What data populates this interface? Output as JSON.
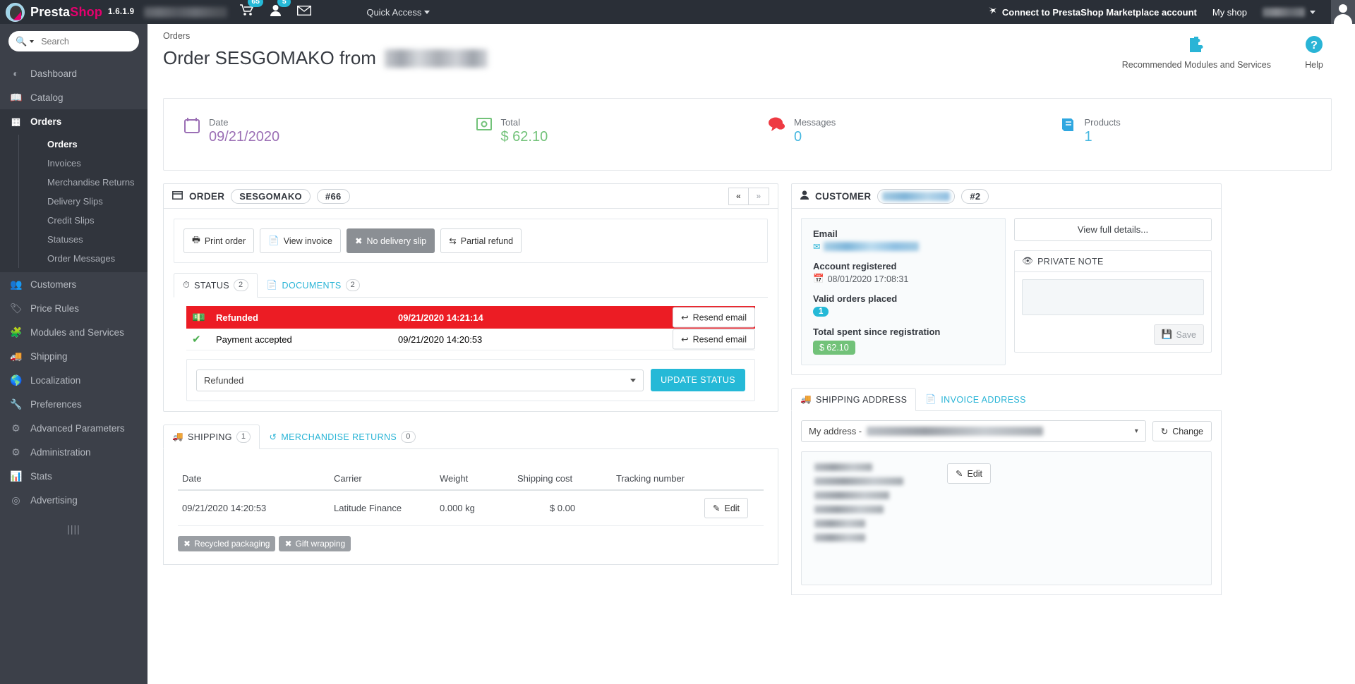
{
  "topbar": {
    "brand": "PrestaShop",
    "brand_pink_part": "Shop",
    "brand_plain_part": "Presta",
    "version": "1.6.1.9",
    "shop_name_redacted": true,
    "cart_badge": "65",
    "customer_badge": "5",
    "quick_access": "Quick Access",
    "connect_label": "Connect to PrestaShop Marketplace account",
    "my_shop": "My shop",
    "employee_name_redacted": true,
    "icons": {
      "cart": "cart-icon",
      "customers": "person-icon",
      "mail": "envelope-icon",
      "connect": "prestashop-mark-icon",
      "avatar": "avatar"
    }
  },
  "sidebar": {
    "search_placeholder": "Search",
    "items": [
      {
        "label": "Dashboard",
        "icon": "dashboard-icon",
        "active": false
      },
      {
        "label": "Catalog",
        "icon": "book-icon",
        "active": false
      },
      {
        "label": "Orders",
        "icon": "credit-card-icon",
        "active": true
      },
      {
        "label": "Customers",
        "icon": "users-icon",
        "active": false
      },
      {
        "label": "Price Rules",
        "icon": "tag-icon",
        "active": false
      },
      {
        "label": "Modules and Services",
        "icon": "puzzle-icon",
        "active": false
      },
      {
        "label": "Shipping",
        "icon": "truck-icon",
        "active": false
      },
      {
        "label": "Localization",
        "icon": "globe-icon",
        "active": false
      },
      {
        "label": "Preferences",
        "icon": "wrench-icon",
        "active": false
      },
      {
        "label": "Advanced Parameters",
        "icon": "cogs-icon",
        "active": false
      },
      {
        "label": "Administration",
        "icon": "gear-icon",
        "active": false
      },
      {
        "label": "Stats",
        "icon": "bar-chart-icon",
        "active": false
      },
      {
        "label": "Advertising",
        "icon": "bullseye-icon",
        "active": false
      }
    ],
    "submenu": [
      {
        "label": "Orders",
        "active": true
      },
      {
        "label": "Invoices",
        "active": false
      },
      {
        "label": "Merchandise Returns",
        "active": false
      },
      {
        "label": "Delivery Slips",
        "active": false
      },
      {
        "label": "Credit Slips",
        "active": false
      },
      {
        "label": "Statuses",
        "active": false
      },
      {
        "label": "Order Messages",
        "active": false
      }
    ]
  },
  "page": {
    "breadcrumb": "Orders",
    "title_prefix": "Order SESGOMAKO from",
    "customer_name_redacted": true,
    "tools": [
      {
        "label": "Recommended Modules and Services",
        "icon": "puzzle-icon"
      },
      {
        "label": "Help",
        "icon": "help-icon"
      }
    ]
  },
  "kpis": [
    {
      "label": "Date",
      "value": "09/21/2020",
      "icon": "calendar-icon",
      "icon_color": "#9b6fb5",
      "value_color": "#9b6fb5"
    },
    {
      "label": "Total",
      "value": "$ 62.10",
      "icon": "money-icon",
      "icon_color": "#72c279",
      "value_color": "#72c279"
    },
    {
      "label": "Messages",
      "value": "0",
      "icon": "chat-icon",
      "icon_color": "#ee3a42",
      "value_color": "#45b7e0"
    },
    {
      "label": "Products",
      "value": "1",
      "icon": "book-icon",
      "icon_color": "#2fa7e0",
      "value_color": "#45b7e0"
    }
  ],
  "order_panel": {
    "header_label": "ORDER",
    "reference": "SESGOMAKO",
    "id": "#66",
    "nav_prev": "«",
    "nav_next": "»",
    "actions": [
      {
        "label": "Print order",
        "icon": "printer-icon",
        "style": "default"
      },
      {
        "label": "View invoice",
        "icon": "file-icon",
        "style": "default"
      },
      {
        "label": "No delivery slip",
        "icon": "x-icon",
        "style": "gray-solid"
      },
      {
        "label": "Partial refund",
        "icon": "exchange-icon",
        "style": "default"
      }
    ],
    "tabs": [
      {
        "label": "STATUS",
        "count": "2",
        "icon": "clock-icon",
        "active": true
      },
      {
        "label": "DOCUMENTS",
        "count": "2",
        "icon": "file-icon",
        "active": false
      }
    ],
    "statuses": [
      {
        "name": "Refunded",
        "date": "09/21/2020 14:21:14",
        "icon": "money-icon",
        "button": "Resend email",
        "highlight": true
      },
      {
        "name": "Payment accepted",
        "date": "09/21/2020 14:20:53",
        "icon": "check-icon",
        "button": "Resend email",
        "highlight": false
      }
    ],
    "status_select_value": "Refunded",
    "update_button": "UPDATE STATUS"
  },
  "shipping_panel": {
    "tabs": [
      {
        "label": "SHIPPING",
        "count": "1",
        "icon": "truck-icon",
        "active": true
      },
      {
        "label": "MERCHANDISE RETURNS",
        "count": "0",
        "icon": "return-icon",
        "active": false
      }
    ],
    "columns": [
      "Date",
      "Carrier",
      "Weight",
      "Shipping cost",
      "Tracking number",
      ""
    ],
    "rows": [
      {
        "date": "09/21/2020 14:20:53",
        "carrier": "Latitude Finance",
        "weight": "0.000 kg",
        "shipping_cost": "$ 0.00",
        "tracking_number": "",
        "action": "Edit"
      }
    ],
    "badges": [
      {
        "label": "Recycled packaging",
        "icon": "x-icon"
      },
      {
        "label": "Gift wrapping",
        "icon": "x-icon"
      }
    ]
  },
  "customer_panel": {
    "header_label": "CUSTOMER",
    "name_redacted": true,
    "id": "#2",
    "email_label": "Email",
    "email_redacted": true,
    "registered_label": "Account registered",
    "registered_date": "08/01/2020 17:08:31",
    "valid_orders_label": "Valid orders placed",
    "valid_orders_count": "1",
    "total_spent_label": "Total spent since registration",
    "total_spent": "$ 62.10",
    "view_details": "View full details...",
    "private_note_label": "PRIVATE NOTE",
    "private_note_value": "",
    "save_label": "Save"
  },
  "address_panel": {
    "tabs": [
      {
        "label": "SHIPPING ADDRESS",
        "icon": "truck-icon",
        "active": true
      },
      {
        "label": "INVOICE ADDRESS",
        "icon": "file-icon",
        "active": false
      }
    ],
    "select_prefix": "My address -",
    "select_rest_redacted": true,
    "change_button": "Change",
    "edit_button": "Edit",
    "address_lines_redacted": 6
  },
  "colors": {
    "brand_pink": "#e6006e",
    "accent_blue": "#25b9d7",
    "danger_red": "#ec1c24",
    "success_green": "#72c279",
    "purple": "#9b6fb5",
    "sidebar_bg": "#3c4049",
    "topbar_bg": "#2a2f37"
  }
}
